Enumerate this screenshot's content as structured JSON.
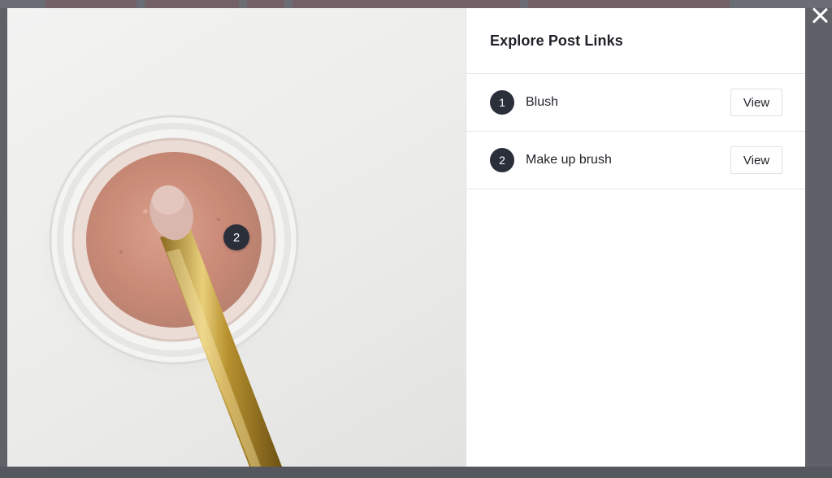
{
  "panel": {
    "title": "Explore Post Links",
    "links": [
      {
        "number": "1",
        "label": "Blush",
        "action": "View"
      },
      {
        "number": "2",
        "label": "Make up brush",
        "action": "View"
      }
    ]
  },
  "hotspot": {
    "number": "2"
  },
  "icons": {
    "close": "close-icon"
  },
  "colors": {
    "overlay": "#5f6168",
    "badge": "#2b2f3a",
    "panel_bg": "#ffffff"
  }
}
